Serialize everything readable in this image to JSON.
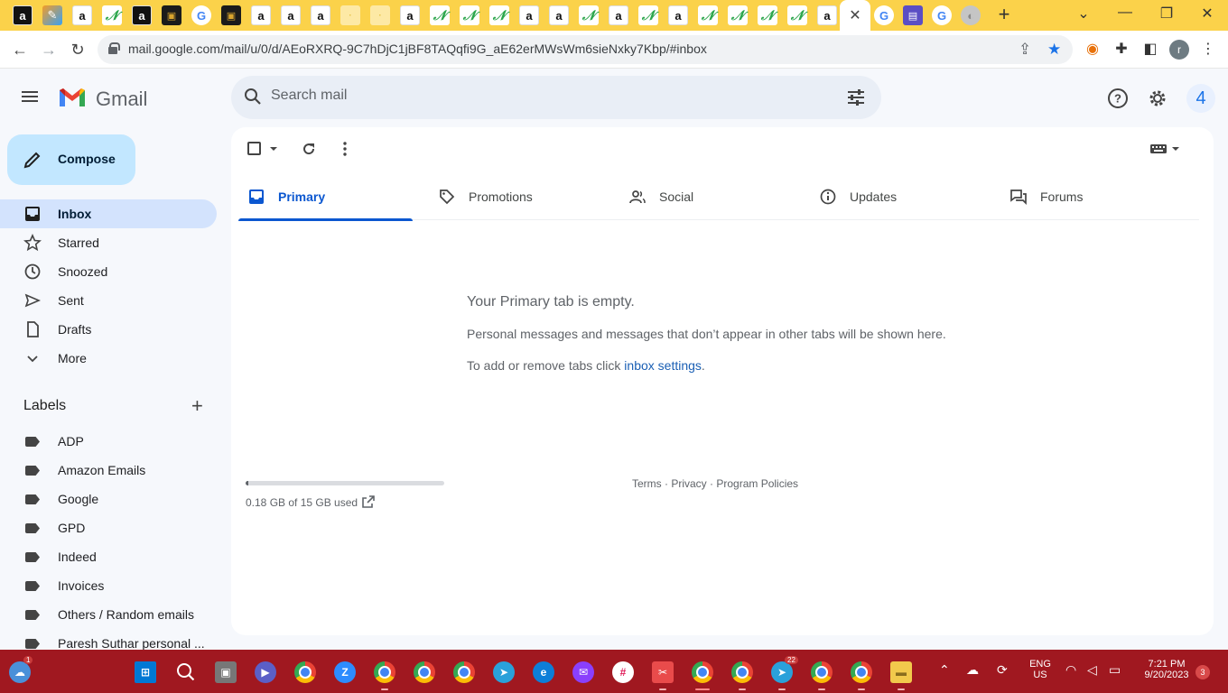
{
  "browser": {
    "url": "mail.google.com/mail/u/0/d/AEoRXRQ-9C7hDjC1jBF8TAQqfi9G_aE62erMWsWm6sieNxky7Kbp/#inbox",
    "profile_initial": "r",
    "close_tab_glyph": "✕",
    "new_tab_glyph": "+",
    "back_glyph": "←",
    "forward_glyph": "→",
    "reload_glyph": "↻",
    "menu_glyph": "⋮",
    "tab_icons": [
      "amazon-icon",
      "pencil-icon",
      "amazon-icon",
      "green-app-icon",
      "amazon-icon",
      "game-icon",
      "google-icon",
      "game-icon",
      "amazon-icon",
      "amazon-icon",
      "amazon-icon",
      "pale-icon",
      "pale-icon",
      "amazon-icon",
      "green-app-icon",
      "green-app-icon",
      "green-app-icon",
      "amazon-icon",
      "amazon-icon",
      "green-app-icon",
      "amazon-icon",
      "green-app-icon",
      "amazon-icon",
      "green-app-icon",
      "green-app-icon",
      "green-app-icon",
      "green-app-icon",
      "amazon-icon"
    ],
    "tab_glyphs": [
      "a",
      "✎",
      "a",
      "𝒩",
      "a",
      "▣",
      "G",
      "▣",
      "a",
      "a",
      "a",
      "·",
      "·",
      "a",
      "𝒩",
      "𝒩",
      "𝒩",
      "a",
      "a",
      "𝒩",
      "a",
      "𝒩",
      "a",
      "𝒩",
      "𝒩",
      "𝒩",
      "𝒩",
      "a"
    ]
  },
  "gmail": {
    "logo_text": "Gmail",
    "search_placeholder": "Search mail",
    "account_initial": "4",
    "compose_label": "Compose"
  },
  "nav": [
    {
      "label": "Inbox",
      "icon": "inbox-icon",
      "active": true
    },
    {
      "label": "Starred",
      "icon": "star-icon",
      "active": false
    },
    {
      "label": "Snoozed",
      "icon": "clock-icon",
      "active": false
    },
    {
      "label": "Sent",
      "icon": "send-icon",
      "active": false
    },
    {
      "label": "Drafts",
      "icon": "draft-icon",
      "active": false
    },
    {
      "label": "More",
      "icon": "chevron-down-icon",
      "active": false
    }
  ],
  "labels_heading": "Labels",
  "labels": [
    "ADP",
    "Amazon Emails",
    "Google",
    "GPD",
    "Indeed",
    "Invoices",
    "Others / Random emails",
    "Paresh Suthar personal ..."
  ],
  "categories": [
    {
      "label": "Primary",
      "icon": "inbox-tab-icon",
      "active": true
    },
    {
      "label": "Promotions",
      "icon": "tag-icon",
      "active": false
    },
    {
      "label": "Social",
      "icon": "people-icon",
      "active": false
    },
    {
      "label": "Updates",
      "icon": "info-icon",
      "active": false
    },
    {
      "label": "Forums",
      "icon": "forum-icon",
      "active": false
    }
  ],
  "empty_state": {
    "title": "Your Primary tab is empty.",
    "description": "Personal messages and messages that don’t appear in other tabs will be shown here.",
    "hint_prefix": "To add or remove tabs click ",
    "hint_link": "inbox settings",
    "hint_suffix": "."
  },
  "storage": {
    "text": "0.18 GB of 15 GB used",
    "used_fraction": 0.012
  },
  "footer": {
    "terms": "Terms",
    "privacy": "Privacy",
    "policies": "Program Policies",
    "separator": " · "
  },
  "taskbar": {
    "badge_notifications": "1",
    "badge_telegram": "22",
    "language_top": "ENG",
    "language_bottom": "US",
    "time": "7:21 PM",
    "date": "9/20/2023",
    "notification_count": "3"
  },
  "colors": {
    "accent": "#0b57d0",
    "compose_bg": "#c2e7ff",
    "active_nav_bg": "#d3e3fd",
    "tabstrip_bg": "#fbd24a",
    "taskbar_bg": "#a01820"
  }
}
